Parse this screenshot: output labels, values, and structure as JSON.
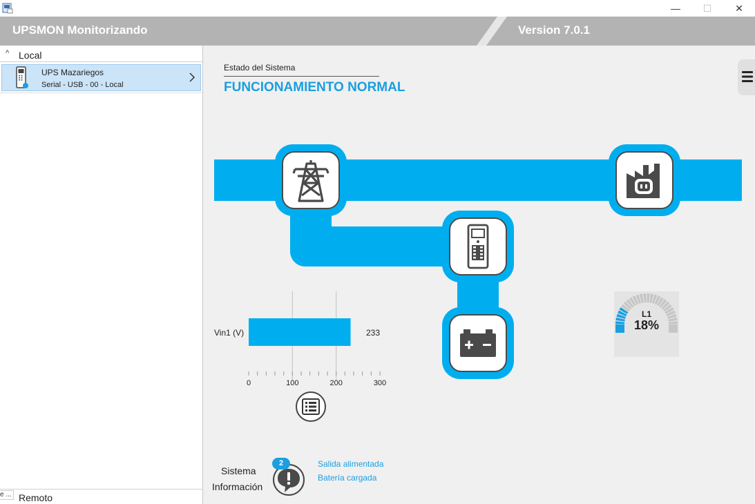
{
  "window": {
    "minimize_glyph": "—",
    "maximize_glyph": "☐",
    "close_glyph": "✕"
  },
  "header": {
    "title": "UPSMON Monitorizando",
    "version": "Version 7.0.1"
  },
  "sidebar": {
    "local_label": "Local",
    "local_chevron": "^",
    "device": {
      "name": "UPS Mazariegos",
      "detail": "Serial - USB - 00 - Local"
    },
    "remote_label": "Remoto",
    "tooltip_stub": "e ..."
  },
  "main": {
    "status_label": "Estado del Sistema",
    "status_value": "FUNCIONAMIENTO NORMAL"
  },
  "chart_data": {
    "type": "bar",
    "categories": [
      "Vin1 (V)"
    ],
    "values": [
      233
    ],
    "value_labels": [
      "233"
    ],
    "xlim": [
      0,
      300
    ],
    "ticks": [
      0,
      100,
      200,
      300
    ],
    "tick_labels": [
      "0",
      "100",
      "200",
      "300"
    ],
    "gridlines": [
      100,
      200
    ],
    "color": "#00aeef"
  },
  "gauge": {
    "label": "L1",
    "value_text": "18%",
    "fraction": 0.18,
    "active_color": "#1a9fe0",
    "inactive_color": "#c6c6c6"
  },
  "system_info": {
    "title_line1": "Sistema",
    "title_line2": "Información",
    "badge_count": "2",
    "messages": [
      "Salida alimentada",
      "Batería cargada"
    ]
  },
  "colors": {
    "accent": "#00aeef",
    "status_text": "#1a9fe0",
    "header_bg": "#b3b3b3",
    "selection_bg": "#cce4f7"
  },
  "icons": [
    "app-icon",
    "power-tower-icon",
    "ups-device-icon",
    "battery-icon",
    "factory-outlet-icon",
    "list-icon",
    "alert-icon",
    "menu-icon"
  ]
}
